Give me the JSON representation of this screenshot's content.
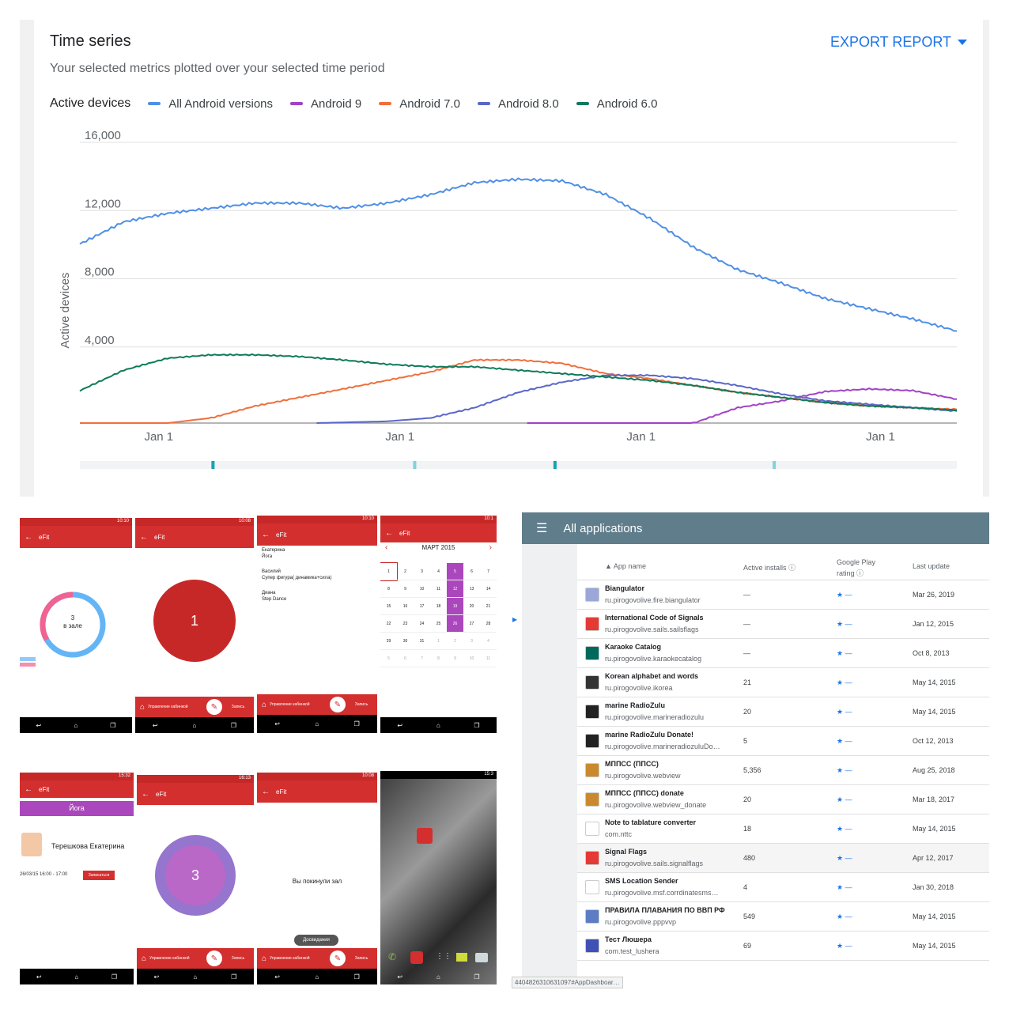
{
  "card": {
    "title": "Time series",
    "subtitle": "Your selected metrics plotted over your selected time period",
    "export_label": "EXPORT REPORT",
    "legend_title": "Active devices"
  },
  "chart_data": {
    "type": "line",
    "ylabel": "Active devices",
    "ylim": [
      0,
      16000
    ],
    "yticks": [
      "16,000",
      "12,000",
      "8,000",
      "4,000"
    ],
    "xticks": [
      "Jan 1",
      "Jan 1",
      "Jan 1",
      "Jan 1"
    ],
    "grid": true,
    "legend_position": "top",
    "series": [
      {
        "name": "All Android versions",
        "color": "#4f8fe6",
        "x": [
          0,
          0.05,
          0.1,
          0.15,
          0.2,
          0.25,
          0.3,
          0.35,
          0.4,
          0.45,
          0.5,
          0.55,
          0.6,
          0.65,
          0.7,
          0.75,
          0.8,
          0.85,
          0.9,
          0.95,
          1.0
        ],
        "y": [
          10500,
          11800,
          12300,
          12600,
          12900,
          12900,
          12600,
          12900,
          13400,
          14100,
          14300,
          14200,
          13400,
          12000,
          10300,
          9000,
          8200,
          7300,
          6700,
          6100,
          5400
        ]
      },
      {
        "name": "Android 9",
        "color": "#a142c7",
        "x": [
          0.51,
          0.65,
          0.7,
          0.75,
          0.8,
          0.85,
          0.9,
          0.95,
          1.0
        ],
        "y": [
          0,
          0,
          0,
          900,
          1300,
          1850,
          2000,
          1900,
          1400
        ]
      },
      {
        "name": "Android 7.0",
        "color": "#f06f3a",
        "x": [
          0,
          0.1,
          0.15,
          0.2,
          0.25,
          0.3,
          0.35,
          0.4,
          0.45,
          0.5,
          0.55,
          0.6,
          0.65,
          0.7,
          0.75,
          0.8,
          0.85,
          0.9,
          0.95,
          1.0
        ],
        "y": [
          0,
          0,
          300,
          1000,
          1500,
          2000,
          2500,
          3000,
          3700,
          3700,
          3500,
          2900,
          2600,
          2200,
          1800,
          1500,
          1200,
          1000,
          900,
          800
        ]
      },
      {
        "name": "Android 8.0",
        "color": "#5a67c8",
        "x": [
          0.27,
          0.35,
          0.4,
          0.45,
          0.5,
          0.55,
          0.6,
          0.65,
          0.7,
          0.75,
          0.8,
          0.85,
          0.9,
          0.95,
          1.0
        ],
        "y": [
          0,
          100,
          300,
          900,
          1800,
          2400,
          2800,
          2800,
          2600,
          2200,
          1700,
          1300,
          1100,
          900,
          700
        ]
      },
      {
        "name": "Android 6.0",
        "color": "#0d7a5a",
        "x": [
          0,
          0.05,
          0.1,
          0.15,
          0.2,
          0.25,
          0.3,
          0.35,
          0.4,
          0.45,
          0.5,
          0.55,
          0.6,
          0.65,
          0.7,
          0.75,
          0.8,
          0.85,
          0.9,
          0.95,
          1.0
        ],
        "y": [
          1900,
          3100,
          3800,
          4000,
          4000,
          3900,
          3700,
          3450,
          3300,
          3300,
          3100,
          2900,
          2700,
          2500,
          2200,
          1800,
          1500,
          1200,
          1000,
          900,
          750
        ]
      }
    ]
  },
  "phones": {
    "app_name": "eFit",
    "p1": {
      "ring_count": "3",
      "ring_label": "в зале",
      "time": "10:10"
    },
    "p2": {
      "count": "1",
      "time": "10:08"
    },
    "p3": {
      "items": [
        {
          "name": "Екатерина",
          "class": "Йога"
        },
        {
          "name": "Василий",
          "class": "Супер фигура( динамика+сила)"
        },
        {
          "name": "Диана",
          "class": "Step Dance"
        }
      ],
      "time": "10:10"
    },
    "p4": {
      "month": "МАРТ 2015",
      "time": "10:1",
      "rows": [
        [
          "1",
          "2",
          "3",
          "4",
          "5",
          "6",
          "7"
        ],
        [
          "8",
          "9",
          "10",
          "11",
          "12",
          "13",
          "14"
        ],
        [
          "15",
          "16",
          "17",
          "18",
          "19",
          "20",
          "21"
        ],
        [
          "22",
          "23",
          "24",
          "25",
          "26",
          "27",
          "28"
        ],
        [
          "29",
          "30",
          "31",
          "1",
          "2",
          "3",
          "4"
        ],
        [
          "5",
          "6",
          "7",
          "8",
          "9",
          "10",
          "11"
        ]
      ]
    },
    "p5": {
      "tab": "Йога",
      "person": "Терешкова Екатерина",
      "slot": "26/03/15  16:00 - 17:00",
      "btn": "Записаться",
      "time": "15:32"
    },
    "p6": {
      "count": "3",
      "time": "16:13"
    },
    "p7": {
      "message": "Вы покинули зал",
      "toast": "Досвидания",
      "time": "10:08"
    },
    "bottom_left": "Управление кабинкой",
    "bottom_right": "Запись"
  },
  "apps": {
    "title": "All applications",
    "columns": {
      "name": "App name",
      "installs": "Active installs",
      "rating": "Google Play rating",
      "updated": "Last update"
    },
    "rows": [
      {
        "name": "Biangulator",
        "pkg": "ru.pirogovolive.fire.biangulator",
        "installs": "—",
        "rating": "★ —",
        "updated": "Mar 26, 2019",
        "color": "#9aa7d8"
      },
      {
        "name": "International Code of Signals",
        "pkg": "ru.pirogovolive.sails.sailsflags",
        "installs": "—",
        "rating": "★ —",
        "updated": "Jan 12, 2015",
        "color": "#e53935"
      },
      {
        "name": "Karaoke Catalog",
        "pkg": "ru.pirogovolive.karaokecatalog",
        "installs": "—",
        "rating": "★ —",
        "updated": "Oct 8, 2013",
        "color": "#00695c"
      },
      {
        "name": "Korean alphabet and words",
        "pkg": "ru.pirogovolive.ikorea",
        "installs": "21",
        "rating": "★ —",
        "updated": "May 14, 2015",
        "color": "#333333"
      },
      {
        "name": "marine RadioZulu",
        "pkg": "ru.pirogovolive.marineradiozulu",
        "installs": "20",
        "rating": "★ —",
        "updated": "May 14, 2015",
        "color": "#222222"
      },
      {
        "name": "marine RadioZulu Donate!",
        "pkg": "ru.pirogovolive.marineradiozuluDo…",
        "installs": "5",
        "rating": "★ —",
        "updated": "Oct 12, 2013",
        "color": "#222222"
      },
      {
        "name": "МППСС (ППСС)",
        "pkg": "ru.pirogovolive.webview",
        "installs": "5,356",
        "rating": "★ —",
        "updated": "Aug 25, 2018",
        "color": "#c98a2e"
      },
      {
        "name": "МППСС (ППСС) donate",
        "pkg": "ru.pirogovolive.webview_donate",
        "installs": "20",
        "rating": "★ —",
        "updated": "Mar 18, 2017",
        "color": "#c98a2e"
      },
      {
        "name": "Note to tablature converter",
        "pkg": "com.nttc",
        "installs": "18",
        "rating": "★ —",
        "updated": "May 14, 2015",
        "color": "#ffffff"
      },
      {
        "name": "Signal Flags",
        "pkg": "ru.pirogovolive.sails.signalflags",
        "installs": "480",
        "rating": "★ —",
        "updated": "Apr 12, 2017",
        "color": "#e53935"
      },
      {
        "name": "SMS Location Sender",
        "pkg": "ru.pirogovolive.msf.corrdinatesms…",
        "installs": "4",
        "rating": "★ —",
        "updated": "Jan 30, 2018",
        "color": "#ffffff"
      },
      {
        "name": "ПРАВИЛА ПЛАВАНИЯ ПО ВВП РФ",
        "pkg": "ru.pirogovolive.pppvvp",
        "installs": "549",
        "rating": "★ —",
        "updated": "May 14, 2015",
        "color": "#5c7cc4"
      },
      {
        "name": "Тест Люшера",
        "pkg": "com.test_lushera",
        "installs": "69",
        "rating": "★ —",
        "updated": "May 14, 2015",
        "color": "#3f51b5"
      }
    ],
    "url_tip": "4404826310631097#AppDashboar…"
  }
}
